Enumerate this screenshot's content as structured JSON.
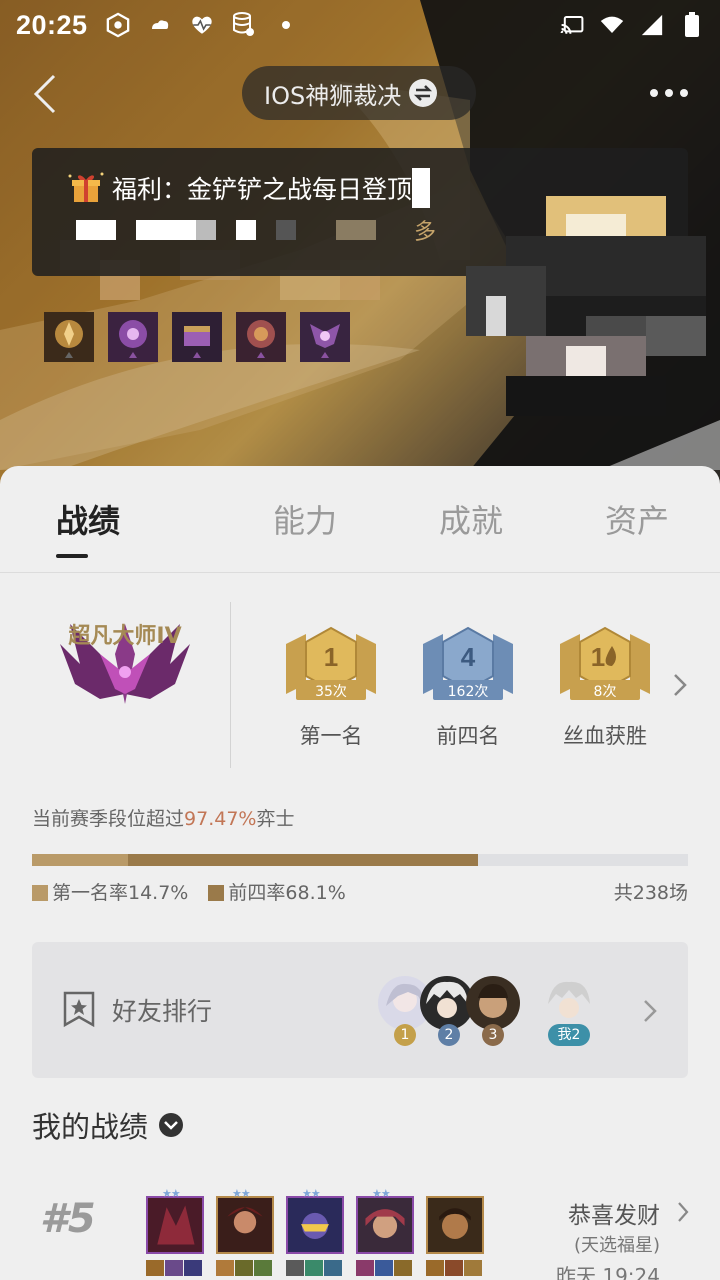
{
  "status_bar": {
    "time": "20:25"
  },
  "nav": {
    "server_name": "IOS神狮裁决"
  },
  "toast": {
    "title": "福利：金铲铲之战每日登顶",
    "more": "多"
  },
  "tabs": [
    {
      "label": "战绩",
      "active": true
    },
    {
      "label": "能力",
      "active": false
    },
    {
      "label": "成就",
      "active": false
    },
    {
      "label": "资产",
      "active": false
    }
  ],
  "rank": {
    "name": "超凡大师IV"
  },
  "medals": [
    {
      "number": "1",
      "count": "35次",
      "label": "第一名",
      "color": "#c8a04e"
    },
    {
      "number": "4",
      "count": "162次",
      "label": "前四名",
      "color": "#6d8db5"
    },
    {
      "number": "1",
      "count": "8次",
      "label": "丝血获胜",
      "color": "#c8a04e"
    }
  ],
  "season": {
    "prefix": "当前赛季段位超过",
    "percent": "97.47%",
    "suffix": "弈士"
  },
  "stats": {
    "first_rate_label": "第一名率14.7%",
    "first_rate": 0.147,
    "top4_rate_label": "前四率68.1%",
    "top4_rate": 0.681,
    "total": "共238场"
  },
  "friends": {
    "title": "好友排行",
    "ranks": [
      "1",
      "2",
      "3"
    ],
    "me": "我2"
  },
  "my_matches": {
    "title": "我的战绩"
  },
  "match": {
    "placement": "#5",
    "title": "恭喜发财",
    "subtitle": "(天选福星)",
    "time": "昨天 19:24"
  },
  "colors": {
    "accent_gold": "#a58a55",
    "highlight": "#c27656",
    "bar_first": "#b99a68",
    "bar_top4": "#9a7a4a"
  }
}
